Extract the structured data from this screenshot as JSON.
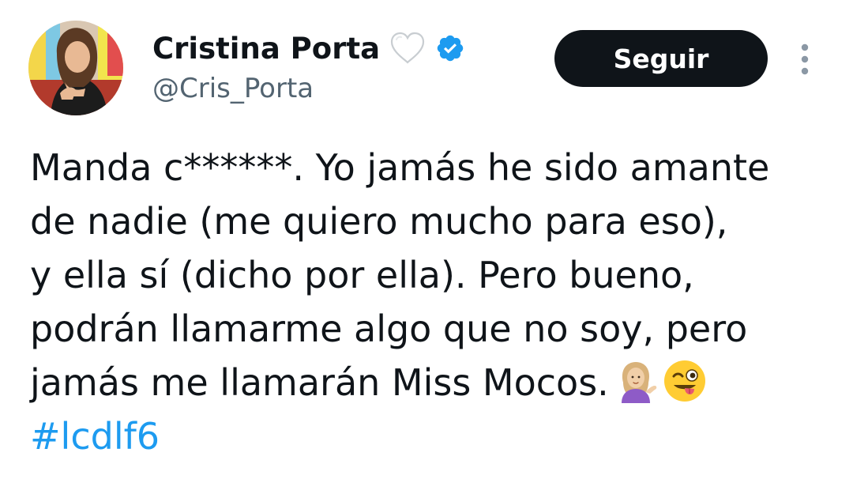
{
  "tweet": {
    "author": {
      "display_name": "Cristina Porta",
      "handle": "@Cris_Porta",
      "name_emoji": "white-heart-icon",
      "verified": true,
      "verified_color": "#1d9bf0"
    },
    "follow_label": "Seguir",
    "text_lines": [
      "Manda c******. Yo jamás he sido amante",
      "de nadie (me quiero mucho para eso),",
      "y ella sí (dicho por ella). Pero bueno,",
      "podrán llamarme algo que no soy, pero",
      "jamás me llamarán Miss Mocos."
    ],
    "trailing_emojis": [
      "woman-tipping-hand-icon",
      "winking-face-with-tongue-icon"
    ],
    "hashtag": "#lcdlf6"
  },
  "colors": {
    "text": "#0f1419",
    "secondary": "#536471",
    "link": "#1d9bf0",
    "button_bg": "#0f1419",
    "button_text": "#ffffff"
  }
}
